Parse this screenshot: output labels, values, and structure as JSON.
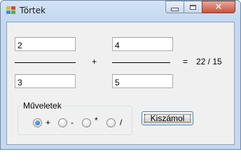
{
  "window": {
    "title": "Törtek",
    "close_glyph": "✕"
  },
  "form": {
    "numerator1": "2",
    "denominator1": "3",
    "numerator2": "4",
    "denominator2": "5",
    "operator_symbol": "+",
    "equals_symbol": "=",
    "result": "22 / 15"
  },
  "operations": {
    "title": "Műveletek",
    "options": [
      {
        "label": "+",
        "checked": true
      },
      {
        "label": "-",
        "checked": false
      },
      {
        "label": "*",
        "checked": false
      },
      {
        "label": "/",
        "checked": false
      }
    ]
  },
  "actions": {
    "calculate_label": "Kiszámol"
  },
  "colors": {
    "title_bar": "#c4d8ef",
    "close_button": "#c8533e",
    "client_background": "#f0f0f0",
    "radio_selected": "#1a5fb4"
  },
  "icons": {
    "app": "app-icon",
    "minimize": "minimize-icon",
    "maximize": "maximize-icon",
    "close": "close-icon"
  }
}
